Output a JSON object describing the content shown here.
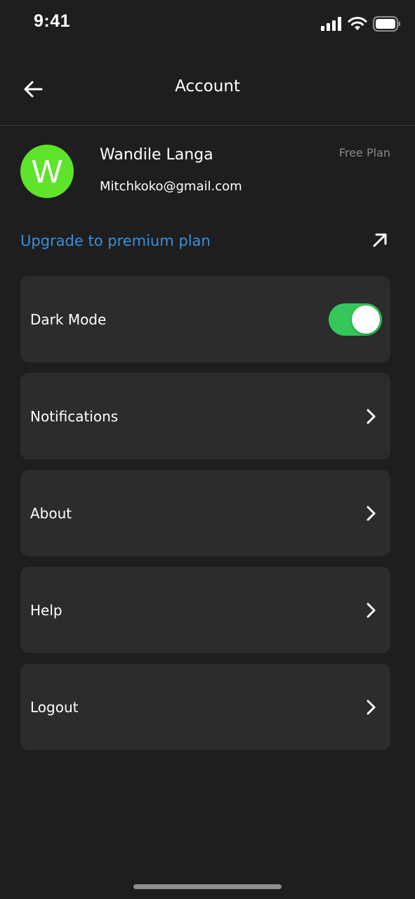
{
  "status_bar": {
    "time": "9:41",
    "icons": [
      "cellular-signal-icon",
      "wifi-icon",
      "battery-icon"
    ]
  },
  "header": {
    "title": "Account",
    "back_icon": "arrow-left-icon"
  },
  "profile": {
    "avatar_initial": "W",
    "avatar_color": "#5fe32b",
    "name": "Wandile Langa",
    "email": "Mitchkoko@gmail.com",
    "plan": "Free Plan"
  },
  "upgrade": {
    "label": "Upgrade to premium plan",
    "color": "#3a8fd9",
    "icon": "arrow-up-right-icon"
  },
  "settings": {
    "dark_mode": {
      "label": "Dark Mode",
      "enabled": true,
      "toggle_color": "#34c759"
    },
    "items": [
      {
        "label": "Notifications",
        "icon": "chevron-right-icon"
      },
      {
        "label": "About",
        "icon": "chevron-right-icon"
      },
      {
        "label": "Help",
        "icon": "chevron-right-icon"
      },
      {
        "label": "Logout",
        "icon": "chevron-right-icon"
      }
    ]
  },
  "colors": {
    "background": "#1e1e1e",
    "card": "#2c2c2c",
    "muted_text": "#8a8a8a"
  }
}
